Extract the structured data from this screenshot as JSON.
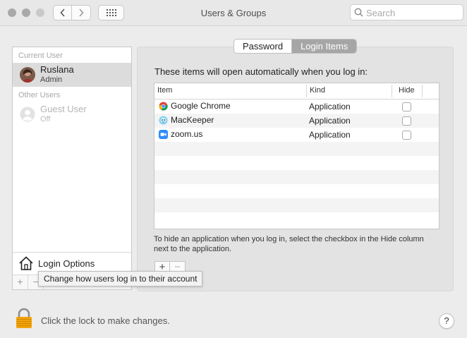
{
  "window": {
    "title": "Users & Groups"
  },
  "search": {
    "placeholder": "Search"
  },
  "sidebar": {
    "current_user_label": "Current User",
    "current_user": {
      "name": "Ruslana",
      "role": "Admin"
    },
    "other_users_label": "Other Users",
    "other_users": [
      {
        "name": "Guest User",
        "status": "Off"
      }
    ],
    "login_options_label": "Login Options",
    "add_symbol": "+",
    "remove_symbol": "−"
  },
  "tooltip": {
    "text": "Change how users log in to their account"
  },
  "tabs": [
    {
      "label": "Password",
      "active": false
    },
    {
      "label": "Login Items",
      "active": true
    }
  ],
  "login_items": {
    "intro": "These items will open automatically when you log in:",
    "columns": {
      "item": "Item",
      "kind": "Kind",
      "hide": "Hide"
    },
    "rows": [
      {
        "item": "Google Chrome",
        "kind": "Application",
        "hide": false,
        "icon": "chrome-icon"
      },
      {
        "item": "MacKeeper",
        "kind": "Application",
        "hide": false,
        "icon": "mackeeper-icon"
      },
      {
        "item": "zoom.us",
        "kind": "Application",
        "hide": false,
        "icon": "zoom-icon"
      }
    ],
    "note": "To hide an application when you log in, select the checkbox in the Hide column next to the application.",
    "add_symbol": "+",
    "remove_symbol": "−"
  },
  "footer": {
    "lock_text": "Click the lock to make changes.",
    "help_symbol": "?"
  },
  "colors": {
    "selected_tab": "#a6a6a6",
    "selected_row": "#dcdcdc",
    "lock_orange": "#f0a30a"
  }
}
